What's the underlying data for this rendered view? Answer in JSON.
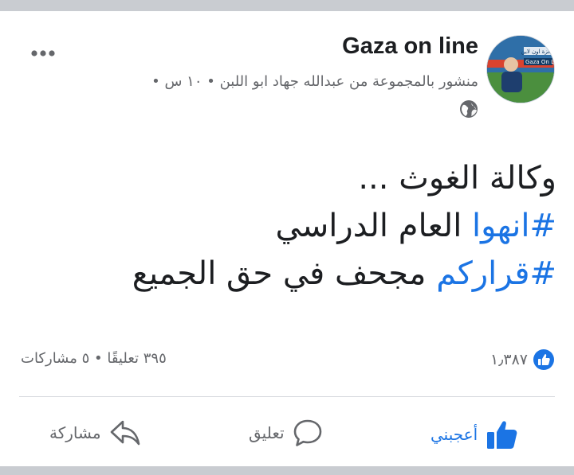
{
  "post": {
    "author": "Gaza on line",
    "avatar_text_top": "غزة اون لاين",
    "avatar_text_bottom": "Gaza On L",
    "meta": "منشور بالمجموعة من عبدالله جهاد ابو اللبن • ١٠ س •",
    "lines": [
      {
        "plain": "وكالة الغوث ...",
        "hashtag": ""
      },
      {
        "hashtag": "#انهوا",
        "plain": " العام الدراسي"
      },
      {
        "hashtag": "#قراركم",
        "plain": " مجحف في حق الجميع"
      }
    ]
  },
  "stats": {
    "likes": "١٫٣٨٧",
    "comments_shares": "٣٩٥ تعليقًا • ٥ مشاركات"
  },
  "actions": {
    "like": "أعجبني",
    "comment": "تعليق",
    "share": "مشاركة"
  },
  "icons": {
    "more": "more-options-icon",
    "globe": "globe-icon",
    "like_badge": "like-badge-icon",
    "like": "thumbs-up-icon",
    "comment": "comment-bubble-icon",
    "share": "share-arrow-icon"
  },
  "colors": {
    "accent": "#1b74e4",
    "text": "#1c1e21",
    "muted": "#65676b",
    "background": "#c9ccd1"
  }
}
